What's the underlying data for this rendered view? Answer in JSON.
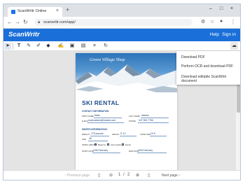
{
  "browser": {
    "tab_title": "ScanWritr Online",
    "tab_close": "×",
    "new_tab": "+",
    "url": "scanwritr.com/app/",
    "controls": {
      "minimize": "–",
      "maximize": "□",
      "close": "×"
    }
  },
  "app": {
    "logo": "ScanWritr",
    "help": "Help",
    "sign_in": "Sign in"
  },
  "document": {
    "shop_name": "Green Village Shop",
    "title": "SKI RENTAL",
    "contact_heading": "CONTACT INFORMATION",
    "first_name_label": "FIRST NAME",
    "first_name": "Mark",
    "last_name_label": "LAST NAME",
    "last_name": "Adams",
    "email_label": "E-MAIL",
    "email": "mark.adams@vesale.com",
    "phone_label": "PHONE",
    "phone": "347 554 7756",
    "skier_heading": "SKIER'S INFORMATION",
    "weight_label": "WEIGHT",
    "weight": "175 pounds",
    "height_label": "HEIGHT",
    "height": "5' 11\"",
    "shoe_label": "SHOE SIZE",
    "shoe": "10.5",
    "age_label": "AGE",
    "age": "48",
    "ability_label": "SKIING ABILITY",
    "ability_1": "Beginner",
    "ability_2": "Intermediate",
    "ability_3": "Expert",
    "start_label": "START DATE",
    "start": "10th February",
    "end_label": "END DATE",
    "end": "20th February"
  },
  "pagination": {
    "previous": "Previous page",
    "current": "1",
    "separator": "/",
    "total": "2",
    "next": "Next page"
  },
  "download_menu": {
    "item_1": "Download PDF",
    "item_2": "Perform OCR and download PDF",
    "item_3": "Download editable ScanWritr document"
  },
  "colors": {
    "header": "#1a6fd9",
    "title": "#1e4d8f"
  }
}
